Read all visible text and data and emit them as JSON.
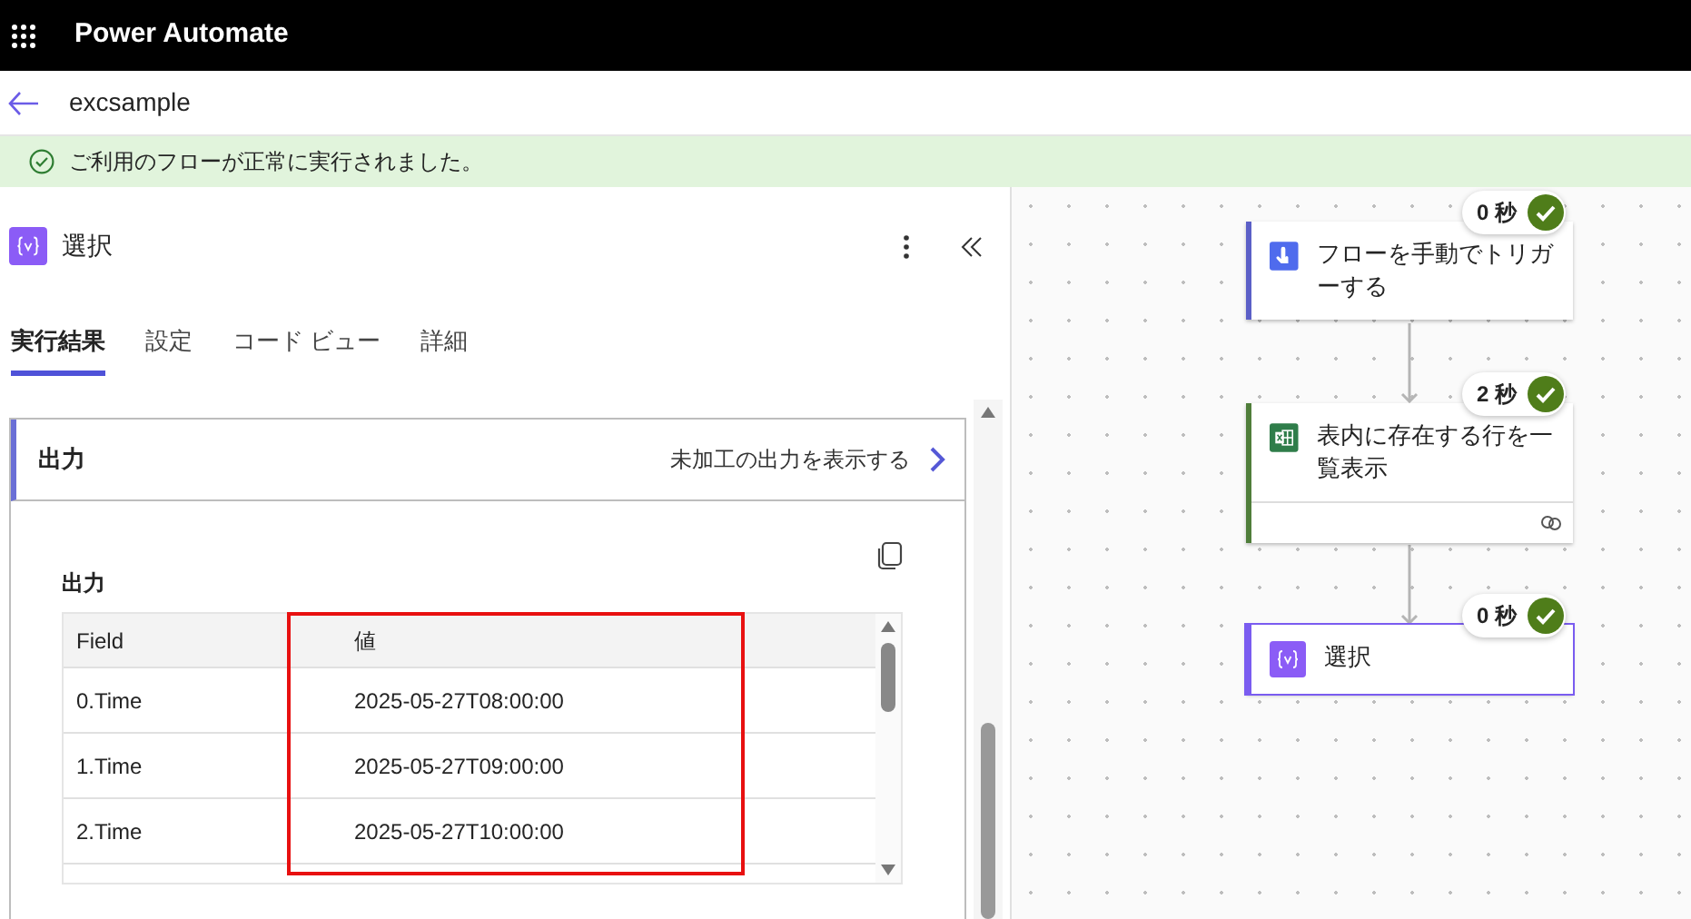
{
  "app": {
    "title": "Power Automate"
  },
  "flow": {
    "name": "excsample"
  },
  "banner": {
    "message": "ご利用のフローが正常に実行されました。"
  },
  "panel": {
    "title": "選択",
    "tabs": [
      {
        "label": "実行結果",
        "selected": true
      },
      {
        "label": "設定",
        "selected": false
      },
      {
        "label": "コード ビュー",
        "selected": false
      },
      {
        "label": "詳細",
        "selected": false
      }
    ],
    "section": {
      "title": "出力",
      "expanded": true,
      "link": "未加工の出力を表示する"
    },
    "output_label": "出力",
    "table": {
      "columns": [
        "Field",
        "値"
      ],
      "rows": [
        [
          "0.Time",
          "2025-05-27T08:00:00"
        ],
        [
          "1.Time",
          "2025-05-27T09:00:00"
        ],
        [
          "2.Time",
          "2025-05-27T10:00:00"
        ]
      ]
    }
  },
  "nodes": [
    {
      "kind": "trigger",
      "title": "フローを手動でトリガーする",
      "duration": "0 秒",
      "succeeded": true,
      "selected": false,
      "color": "#5b5fc7"
    },
    {
      "kind": "excel",
      "title": "表内に存在する行を一覧表示",
      "duration": "2 秒",
      "succeeded": true,
      "selected": false,
      "color": "#4f7d3a"
    },
    {
      "kind": "select",
      "title": "選択",
      "duration": "0 秒",
      "succeeded": true,
      "selected": true,
      "color": "#7a5cf0"
    }
  ]
}
